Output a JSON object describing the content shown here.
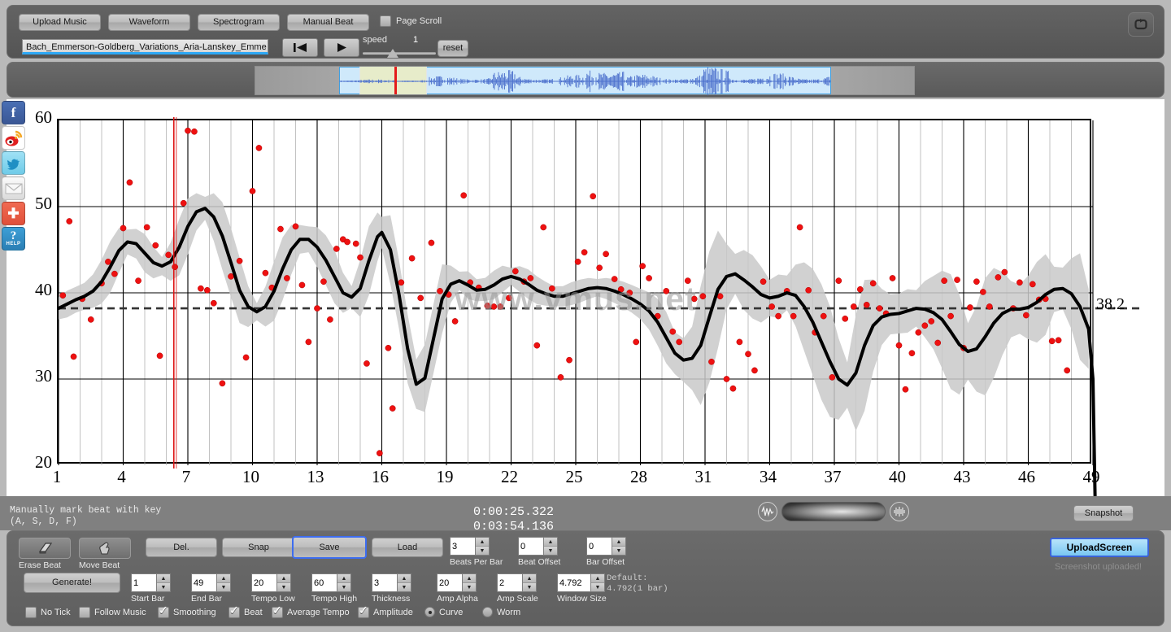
{
  "toolbar": {
    "upload_music": "Upload Music",
    "waveform": "Waveform",
    "spectrogram": "Spectrogram",
    "manual_beat": "Manual Beat",
    "page_scroll": "Page Scroll",
    "page_scroll_checked": false,
    "song_name": "Bach_Emmerson-Goldberg_Variations_Aria-Lanskey_Emme",
    "prev_icon": "skip-to-start-icon",
    "play_icon": "play-icon",
    "speed_label": "speed",
    "speed_value": "1",
    "reset": "reset",
    "loop_icon": "loop-icon"
  },
  "social": [
    {
      "name": "facebook",
      "glyph": "f"
    },
    {
      "name": "weibo",
      "glyph": "W"
    },
    {
      "name": "twitter",
      "glyph": "t"
    },
    {
      "name": "email",
      "glyph": "✉"
    },
    {
      "name": "share-plus",
      "glyph": "✚"
    },
    {
      "name": "help",
      "glyph": "?",
      "sub": "HELP"
    }
  ],
  "status": {
    "hint_line1": "Manually mark beat with key",
    "hint_line2": "(A, S, D, F)",
    "current_time": "0:00:25.322",
    "total_time": "0:03:54.136",
    "snapshot": "Snapshot",
    "volume_left_icon": "waveform-low-icon",
    "volume_right_icon": "waveform-high-icon"
  },
  "controls": {
    "erase_beat": "Erase Beat",
    "move_beat": "Move Beat",
    "erase_icon": "eraser-icon",
    "move_icon": "hand-move-icon",
    "del": "Del.",
    "snap": "Snap",
    "save": "Save",
    "load": "Load",
    "generate": "Generate!",
    "upload_screen": "UploadScreen",
    "upload_status": "Screenshot uploaded!",
    "default_note": "Default:\n4.792(1 bar)",
    "spinners_row1": [
      {
        "name": "beats-per-bar",
        "label": "Beats Per Bar",
        "value": "3"
      },
      {
        "name": "beat-offset",
        "label": "Beat Offset",
        "value": "0"
      },
      {
        "name": "bar-offset",
        "label": "Bar Offset",
        "value": "0"
      }
    ],
    "spinners_row2": [
      {
        "name": "start-bar",
        "label": "Start Bar",
        "value": "1"
      },
      {
        "name": "end-bar",
        "label": "End Bar",
        "value": "49"
      },
      {
        "name": "tempo-low",
        "label": "Tempo Low",
        "value": "20"
      },
      {
        "name": "tempo-high",
        "label": "Tempo High",
        "value": "60"
      },
      {
        "name": "thickness",
        "label": "Thickness",
        "value": "3"
      },
      {
        "name": "amp-alpha",
        "label": "Amp Alpha",
        "value": "20"
      },
      {
        "name": "amp-scale",
        "label": "Amp Scale",
        "value": "2"
      },
      {
        "name": "window-size",
        "label": "Window Size",
        "value": "4.792"
      }
    ],
    "checkboxes": [
      {
        "name": "no-tick",
        "label": "No Tick",
        "checked": false
      },
      {
        "name": "follow-music",
        "label": "Follow Music",
        "checked": false
      },
      {
        "name": "smoothing",
        "label": "Smoothing",
        "checked": true
      },
      {
        "name": "beat",
        "label": "Beat",
        "checked": true
      },
      {
        "name": "average-tempo",
        "label": "Average Tempo",
        "checked": true
      },
      {
        "name": "amplitude",
        "label": "Amplitude",
        "checked": true
      }
    ],
    "radios": [
      {
        "name": "curve",
        "label": "Curve",
        "selected": true
      },
      {
        "name": "worm",
        "label": "Worm",
        "selected": false
      }
    ]
  },
  "chart_data": {
    "type": "line",
    "title": "",
    "watermark": "www.vmus.net",
    "xlabel": "",
    "ylabel": "",
    "xlim": [
      1,
      49
    ],
    "ylim": [
      20,
      60
    ],
    "xticks": [
      1,
      4,
      7,
      10,
      13,
      16,
      19,
      22,
      25,
      28,
      31,
      34,
      37,
      40,
      43,
      46,
      49
    ],
    "yticks": [
      20,
      30,
      40,
      50,
      60
    ],
    "grid": true,
    "average_tempo": 38.2,
    "average_tempo_label": "38.2",
    "playhead_x": 6.35,
    "colors": {
      "beat_points": "#ee1111",
      "tempo_curve": "#000000",
      "amplitude_band": "#c9c9c9",
      "average_line": "#333333",
      "playhead": "#dd1414",
      "grid_major": "#000000",
      "grid_minor": "#a8a8a8"
    },
    "series": [
      {
        "name": "Smoothed Tempo Curve",
        "x": [
          1.0,
          1.4,
          1.8,
          2.2,
          2.6,
          3.0,
          3.4,
          3.8,
          4.2,
          4.6,
          5.0,
          5.4,
          5.8,
          6.2,
          6.6,
          7.0,
          7.4,
          7.8,
          8.2,
          8.6,
          9.0,
          9.4,
          9.8,
          10.2,
          10.6,
          11.0,
          11.4,
          11.8,
          12.2,
          12.6,
          13.0,
          13.4,
          13.8,
          14.2,
          14.6,
          15.0,
          15.4,
          15.8,
          16.0,
          16.4,
          16.8,
          17.2,
          17.6,
          18.0,
          18.4,
          18.8,
          19.2,
          19.6,
          20.0,
          20.4,
          20.8,
          21.2,
          21.6,
          22.0,
          22.4,
          22.8,
          23.2,
          23.6,
          24.0,
          24.4,
          24.8,
          25.2,
          25.6,
          26.0,
          26.4,
          26.8,
          27.2,
          27.6,
          28.0,
          28.4,
          28.8,
          29.2,
          29.6,
          30.0,
          30.4,
          30.8,
          31.2,
          31.6,
          32.0,
          32.4,
          32.8,
          33.2,
          33.6,
          34.0,
          34.4,
          34.8,
          35.2,
          35.6,
          36.0,
          36.4,
          36.8,
          37.2,
          37.6,
          38.0,
          38.4,
          38.8,
          39.2,
          39.6,
          40.0,
          40.4,
          40.8,
          41.2,
          41.6,
          42.0,
          42.4,
          42.8,
          43.2,
          43.6,
          44.0,
          44.4,
          44.8,
          45.2,
          45.6,
          46.0,
          46.4,
          46.8,
          47.2,
          47.6,
          48.0,
          48.4,
          48.8
        ],
        "y": [
          38.2,
          38.7,
          39.2,
          39.6,
          40.2,
          41.3,
          43.0,
          44.9,
          45.9,
          45.7,
          44.6,
          43.5,
          43.1,
          43.6,
          45.3,
          47.7,
          49.4,
          49.8,
          48.8,
          46.6,
          43.5,
          40.3,
          38.4,
          37.8,
          38.4,
          40.2,
          42.8,
          45.0,
          46.2,
          46.2,
          45.3,
          43.8,
          41.9,
          40.0,
          39.5,
          40.5,
          43.7,
          46.5,
          47.0,
          45.0,
          39.8,
          33.5,
          29.4,
          30.1,
          34.7,
          39.3,
          41.0,
          41.4,
          40.9,
          40.3,
          40.4,
          40.9,
          41.6,
          41.9,
          41.6,
          41.0,
          40.3,
          39.9,
          39.6,
          39.6,
          39.9,
          40.2,
          40.5,
          40.6,
          40.5,
          40.2,
          39.8,
          39.3,
          38.7,
          37.9,
          36.6,
          34.8,
          33.0,
          32.2,
          32.4,
          33.9,
          37.2,
          40.4,
          41.9,
          42.2,
          41.5,
          40.7,
          39.8,
          39.4,
          39.6,
          40.0,
          39.7,
          38.4,
          36.6,
          34.3,
          32.0,
          30.0,
          29.3,
          30.7,
          33.9,
          36.2,
          37.2,
          37.5,
          37.6,
          37.9,
          38.2,
          38.1,
          37.7,
          36.9,
          35.5,
          34.0,
          33.2,
          33.5,
          34.9,
          36.5,
          37.6,
          38.1,
          38.1,
          38.3,
          38.9,
          39.8,
          40.4,
          40.5,
          39.9,
          38.4,
          35.8
        ]
      }
    ],
    "beat_points": [
      {
        "x": 1.2,
        "y": 39.7
      },
      {
        "x": 1.5,
        "y": 48.3
      },
      {
        "x": 1.7,
        "y": 32.6
      },
      {
        "x": 2.1,
        "y": 39.3
      },
      {
        "x": 2.5,
        "y": 36.9
      },
      {
        "x": 3.0,
        "y": 41.1
      },
      {
        "x": 3.3,
        "y": 43.6
      },
      {
        "x": 3.6,
        "y": 42.2
      },
      {
        "x": 4.0,
        "y": 47.5
      },
      {
        "x": 4.3,
        "y": 52.8
      },
      {
        "x": 4.7,
        "y": 41.4
      },
      {
        "x": 5.1,
        "y": 47.6
      },
      {
        "x": 5.5,
        "y": 45.5
      },
      {
        "x": 5.7,
        "y": 32.7
      },
      {
        "x": 6.1,
        "y": 44.4
      },
      {
        "x": 6.4,
        "y": 43.0
      },
      {
        "x": 6.8,
        "y": 50.4
      },
      {
        "x": 7.0,
        "y": 58.8
      },
      {
        "x": 7.3,
        "y": 58.7
      },
      {
        "x": 7.6,
        "y": 40.5
      },
      {
        "x": 7.9,
        "y": 40.3
      },
      {
        "x": 8.2,
        "y": 38.8
      },
      {
        "x": 8.6,
        "y": 29.5
      },
      {
        "x": 9.0,
        "y": 41.9
      },
      {
        "x": 9.4,
        "y": 43.7
      },
      {
        "x": 9.7,
        "y": 32.5
      },
      {
        "x": 10.0,
        "y": 51.8
      },
      {
        "x": 10.3,
        "y": 56.8
      },
      {
        "x": 10.6,
        "y": 42.3
      },
      {
        "x": 10.9,
        "y": 40.6
      },
      {
        "x": 11.3,
        "y": 47.4
      },
      {
        "x": 11.6,
        "y": 41.7
      },
      {
        "x": 12.0,
        "y": 47.7
      },
      {
        "x": 12.3,
        "y": 40.9
      },
      {
        "x": 12.6,
        "y": 34.3
      },
      {
        "x": 13.0,
        "y": 38.2
      },
      {
        "x": 13.3,
        "y": 41.3
      },
      {
        "x": 13.6,
        "y": 36.9
      },
      {
        "x": 13.9,
        "y": 45.1
      },
      {
        "x": 14.2,
        "y": 46.2
      },
      {
        "x": 14.4,
        "y": 45.9
      },
      {
        "x": 14.8,
        "y": 45.7
      },
      {
        "x": 15.0,
        "y": 44.1
      },
      {
        "x": 15.3,
        "y": 31.8
      },
      {
        "x": 15.9,
        "y": 21.4
      },
      {
        "x": 16.3,
        "y": 33.6
      },
      {
        "x": 16.5,
        "y": 26.6
      },
      {
        "x": 16.9,
        "y": 41.2
      },
      {
        "x": 17.4,
        "y": 44.0
      },
      {
        "x": 17.8,
        "y": 39.4
      },
      {
        "x": 18.3,
        "y": 45.8
      },
      {
        "x": 18.7,
        "y": 40.2
      },
      {
        "x": 19.1,
        "y": 39.8
      },
      {
        "x": 19.4,
        "y": 36.7
      },
      {
        "x": 19.8,
        "y": 51.3
      },
      {
        "x": 20.1,
        "y": 41.2
      },
      {
        "x": 20.5,
        "y": 40.6
      },
      {
        "x": 20.9,
        "y": 38.5
      },
      {
        "x": 21.2,
        "y": 38.4
      },
      {
        "x": 21.5,
        "y": 38.4
      },
      {
        "x": 21.9,
        "y": 39.4
      },
      {
        "x": 22.2,
        "y": 42.5
      },
      {
        "x": 22.6,
        "y": 41.3
      },
      {
        "x": 22.9,
        "y": 41.7
      },
      {
        "x": 23.2,
        "y": 33.9
      },
      {
        "x": 23.5,
        "y": 47.6
      },
      {
        "x": 23.9,
        "y": 40.5
      },
      {
        "x": 24.3,
        "y": 30.2
      },
      {
        "x": 24.7,
        "y": 32.2
      },
      {
        "x": 25.1,
        "y": 43.6
      },
      {
        "x": 25.4,
        "y": 44.7
      },
      {
        "x": 25.8,
        "y": 51.2
      },
      {
        "x": 26.1,
        "y": 42.9
      },
      {
        "x": 26.4,
        "y": 44.5
      },
      {
        "x": 26.8,
        "y": 41.6
      },
      {
        "x": 27.1,
        "y": 40.4
      },
      {
        "x": 27.5,
        "y": 40.0
      },
      {
        "x": 27.8,
        "y": 34.3
      },
      {
        "x": 28.1,
        "y": 43.1
      },
      {
        "x": 28.4,
        "y": 41.7
      },
      {
        "x": 28.8,
        "y": 37.3
      },
      {
        "x": 29.2,
        "y": 40.2
      },
      {
        "x": 29.5,
        "y": 35.5
      },
      {
        "x": 29.8,
        "y": 34.3
      },
      {
        "x": 30.2,
        "y": 41.4
      },
      {
        "x": 30.5,
        "y": 39.3
      },
      {
        "x": 30.9,
        "y": 39.6
      },
      {
        "x": 31.3,
        "y": 32.0
      },
      {
        "x": 31.7,
        "y": 39.6
      },
      {
        "x": 32.0,
        "y": 30.0
      },
      {
        "x": 32.3,
        "y": 28.9
      },
      {
        "x": 32.6,
        "y": 34.3
      },
      {
        "x": 33.0,
        "y": 32.9
      },
      {
        "x": 33.3,
        "y": 31.0
      },
      {
        "x": 33.7,
        "y": 41.3
      },
      {
        "x": 34.1,
        "y": 38.4
      },
      {
        "x": 34.4,
        "y": 37.3
      },
      {
        "x": 34.8,
        "y": 40.2
      },
      {
        "x": 35.1,
        "y": 37.3
      },
      {
        "x": 35.4,
        "y": 47.6
      },
      {
        "x": 35.8,
        "y": 40.3
      },
      {
        "x": 36.1,
        "y": 35.4
      },
      {
        "x": 36.5,
        "y": 37.3
      },
      {
        "x": 36.9,
        "y": 30.2
      },
      {
        "x": 37.2,
        "y": 41.4
      },
      {
        "x": 37.5,
        "y": 37.0
      },
      {
        "x": 37.9,
        "y": 38.4
      },
      {
        "x": 38.2,
        "y": 40.4
      },
      {
        "x": 38.5,
        "y": 38.6
      },
      {
        "x": 38.8,
        "y": 41.1
      },
      {
        "x": 39.1,
        "y": 38.2
      },
      {
        "x": 39.4,
        "y": 37.6
      },
      {
        "x": 39.7,
        "y": 41.7
      },
      {
        "x": 40.0,
        "y": 33.9
      },
      {
        "x": 40.3,
        "y": 28.8
      },
      {
        "x": 40.6,
        "y": 33.0
      },
      {
        "x": 40.9,
        "y": 35.4
      },
      {
        "x": 41.2,
        "y": 36.2
      },
      {
        "x": 41.5,
        "y": 36.7
      },
      {
        "x": 41.8,
        "y": 34.2
      },
      {
        "x": 42.1,
        "y": 41.4
      },
      {
        "x": 42.4,
        "y": 37.3
      },
      {
        "x": 42.7,
        "y": 41.5
      },
      {
        "x": 43.0,
        "y": 33.6
      },
      {
        "x": 43.3,
        "y": 38.3
      },
      {
        "x": 43.6,
        "y": 41.3
      },
      {
        "x": 43.9,
        "y": 40.1
      },
      {
        "x": 44.2,
        "y": 38.4
      },
      {
        "x": 44.6,
        "y": 41.8
      },
      {
        "x": 44.9,
        "y": 42.4
      },
      {
        "x": 45.3,
        "y": 38.2
      },
      {
        "x": 45.6,
        "y": 41.2
      },
      {
        "x": 45.9,
        "y": 37.4
      },
      {
        "x": 46.2,
        "y": 41.0
      },
      {
        "x": 46.5,
        "y": 39.2
      },
      {
        "x": 46.8,
        "y": 39.3
      },
      {
        "x": 47.1,
        "y": 34.4
      },
      {
        "x": 47.4,
        "y": 34.5
      },
      {
        "x": 47.8,
        "y": 31.0
      }
    ]
  }
}
